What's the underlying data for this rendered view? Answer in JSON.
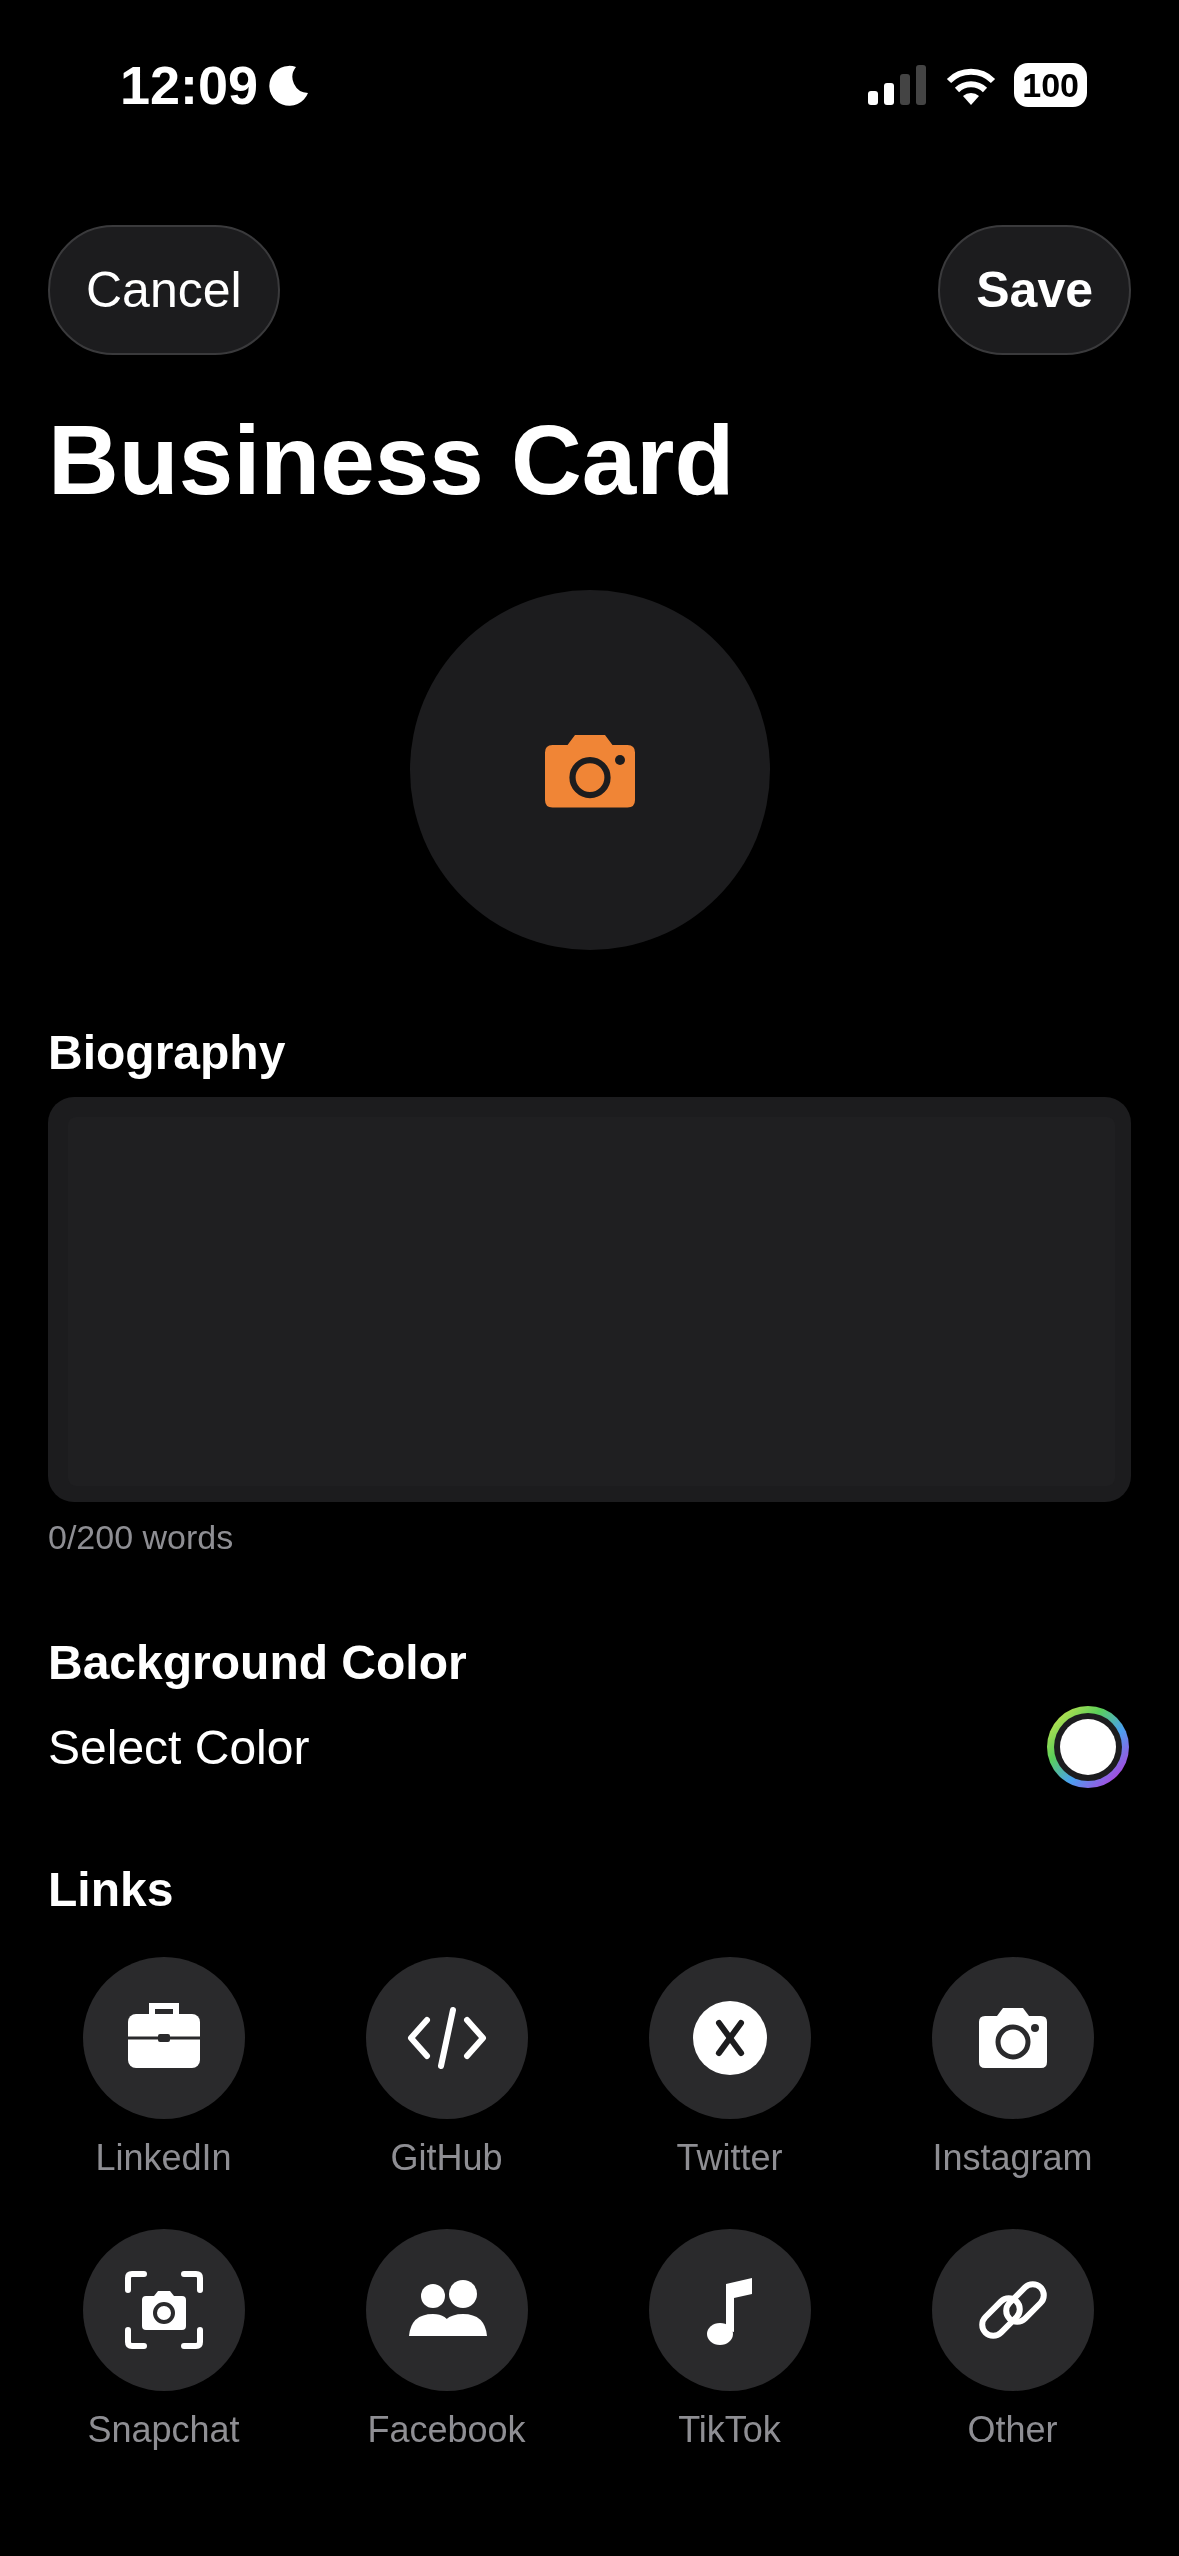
{
  "status_bar": {
    "time": "12:09",
    "battery": "100"
  },
  "nav": {
    "cancel": "Cancel",
    "save": "Save"
  },
  "title": "Business Card",
  "biography": {
    "label": "Biography",
    "counter": "0/200 words"
  },
  "background_color": {
    "label": "Background Color",
    "action": "Select Color"
  },
  "links": {
    "label": "Links",
    "items": [
      {
        "label": "LinkedIn",
        "kind": "briefcase"
      },
      {
        "label": "GitHub",
        "kind": "code"
      },
      {
        "label": "Twitter",
        "kind": "x"
      },
      {
        "label": "Instagram",
        "kind": "camera"
      },
      {
        "label": "Snapchat",
        "kind": "scan"
      },
      {
        "label": "Facebook",
        "kind": "people"
      },
      {
        "label": "TikTok",
        "kind": "note"
      },
      {
        "label": "Other",
        "kind": "link"
      }
    ]
  }
}
